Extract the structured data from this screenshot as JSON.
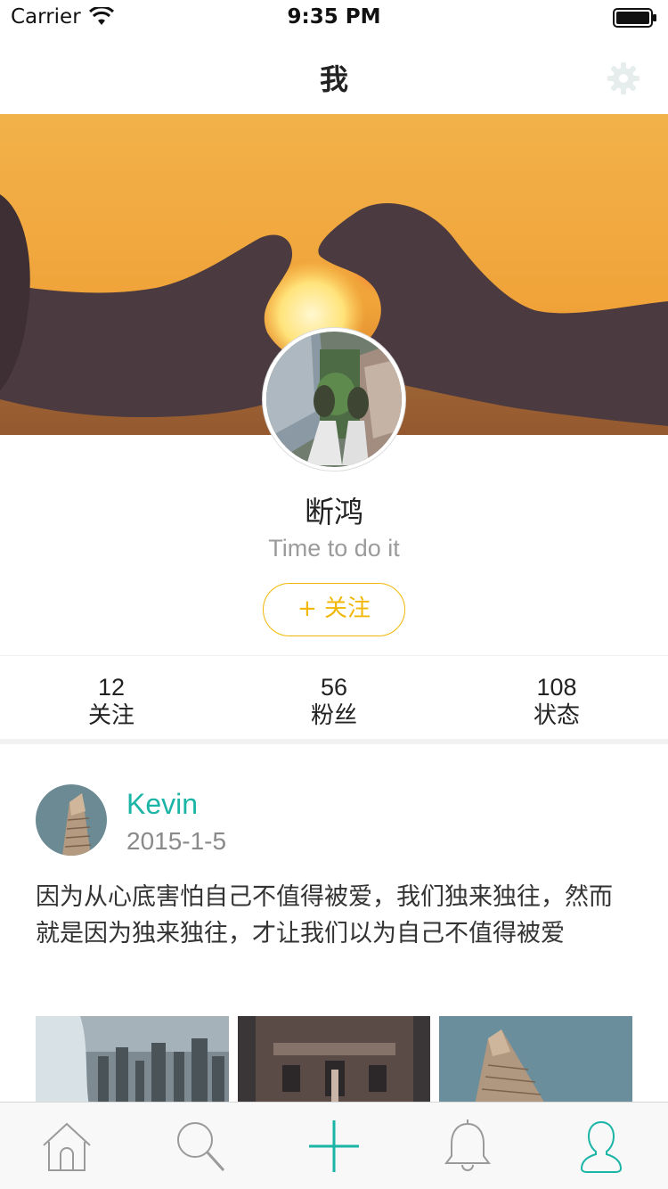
{
  "status_bar": {
    "carrier": "Carrier",
    "time": "9:35 PM"
  },
  "nav": {
    "title": "我",
    "settings_icon": "gear-icon"
  },
  "profile": {
    "name": "断鸿",
    "bio": "Time to do it",
    "follow_label": "+ 关注"
  },
  "stats": [
    {
      "count": "12",
      "label": "关注"
    },
    {
      "count": "56",
      "label": "粉丝"
    },
    {
      "count": "108",
      "label": "状态"
    }
  ],
  "post": {
    "author": "Kevin",
    "date": "2015-1-5",
    "text": "因为从心底害怕自己不值得被爱，我们独来独往，然而就是因为独来独往，才让我们以为自己不值得被爱"
  },
  "tab_bar": {
    "items": [
      "home-icon",
      "search-icon",
      "plus-icon",
      "bell-icon",
      "profile-icon"
    ],
    "active_index": 4
  },
  "colors": {
    "accent": "#1ab5a6",
    "follow": "#f2b705",
    "muted": "#9b9b9b"
  }
}
